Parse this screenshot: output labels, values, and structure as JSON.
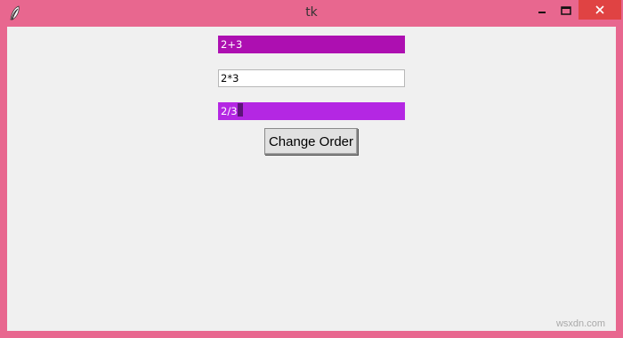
{
  "window": {
    "title": "tk",
    "icon": "feather-icon",
    "controls": [
      "minimize-icon",
      "maximize-icon",
      "close-icon"
    ]
  },
  "entries": [
    {
      "value": "2+3",
      "background": "#ad0fb1",
      "color": "#ffffff"
    },
    {
      "value": "2*3",
      "background": "#ffffff",
      "color": "#000000"
    },
    {
      "value": "2/3",
      "background": "#b427e3",
      "color": "#ffffff"
    }
  ],
  "button": {
    "label": "Change Order"
  },
  "watermark": "wsxdn.com",
  "colors": {
    "titlebar": "#e8678f",
    "close_hover": "#e04343",
    "client": "#f0f0f0"
  }
}
